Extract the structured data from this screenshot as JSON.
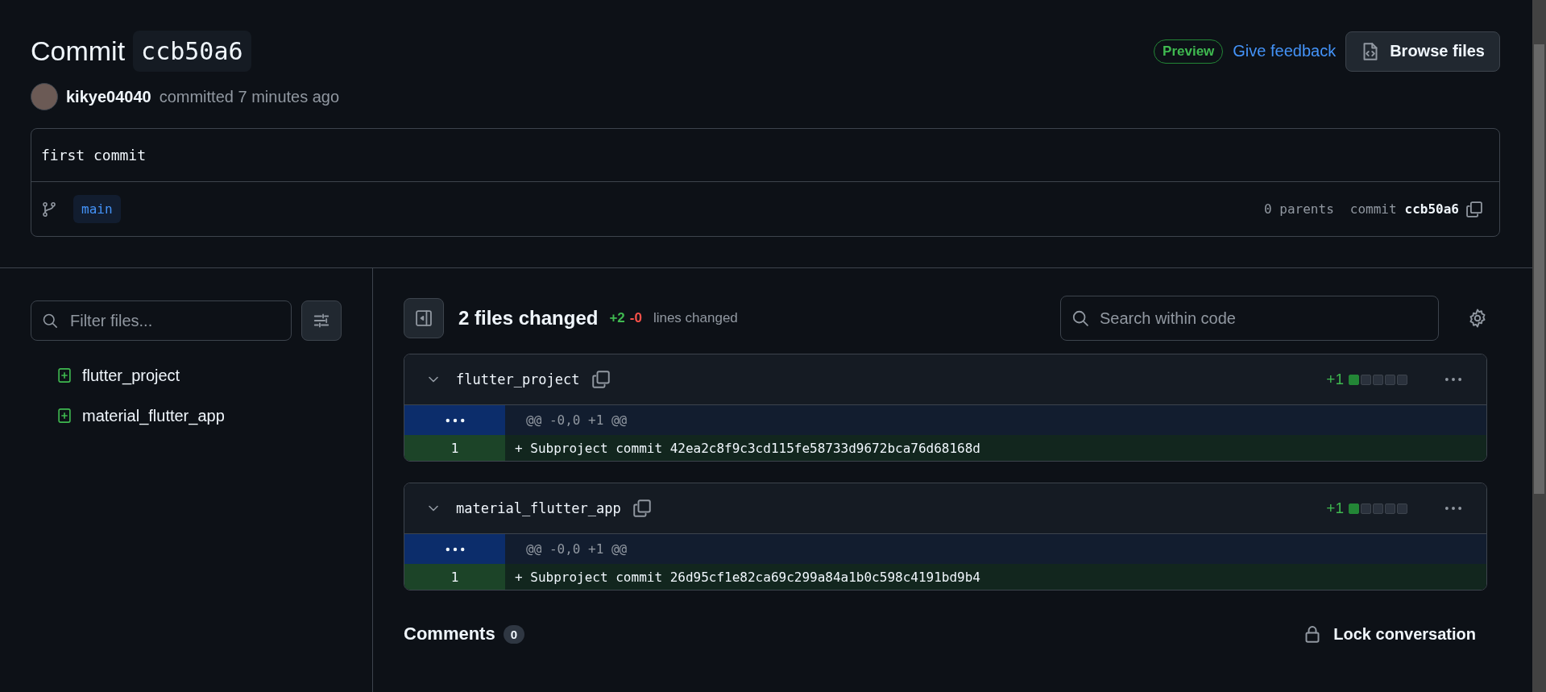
{
  "header": {
    "title": "Commit",
    "sha": "ccb50a6",
    "badge": "Preview",
    "feedback_link": "Give feedback",
    "browse_button": "Browse files"
  },
  "author": {
    "name": "kikye04040",
    "text": "committed 7 minutes ago"
  },
  "commit": {
    "message": "first commit",
    "branch": "main",
    "parents": "0 parents",
    "sha_label": "commit",
    "sha": "ccb50a6"
  },
  "sidebar": {
    "filter": {
      "placeholder": "Filter files..."
    },
    "files": [
      {
        "name": "flutter_project",
        "kind": "added"
      },
      {
        "name": "material_flutter_app",
        "kind": "added"
      }
    ]
  },
  "summary": {
    "title": "2 files changed",
    "additions": "+2",
    "deletions": "-0",
    "label": "lines changed"
  },
  "search": {
    "placeholder": "Search within code"
  },
  "diffs": [
    {
      "file": "flutter_project",
      "expanded": true,
      "additions": "+1",
      "level": 0.2,
      "lines": [
        {
          "kind": "hunk",
          "text": "@@ -0,0 +1 @@"
        },
        {
          "kind": "addition",
          "number": "1",
          "text": "+ Subproject commit 42ea2c8f9c3cd115fe58733d9672bca76d68168d"
        }
      ]
    },
    {
      "file": "material_flutter_app",
      "expanded": true,
      "additions": "+1",
      "level": 0.2,
      "lines": [
        {
          "kind": "hunk",
          "text": "@@ -0,0 +1 @@"
        },
        {
          "kind": "addition",
          "number": "1",
          "text": "+ Subproject commit 26d95cf1e82ca69c299a84a1b0c598c4191bd9b4"
        }
      ]
    }
  ],
  "comments": {
    "title": "Comments",
    "count": "0",
    "lock_button": "Lock conversation"
  }
}
